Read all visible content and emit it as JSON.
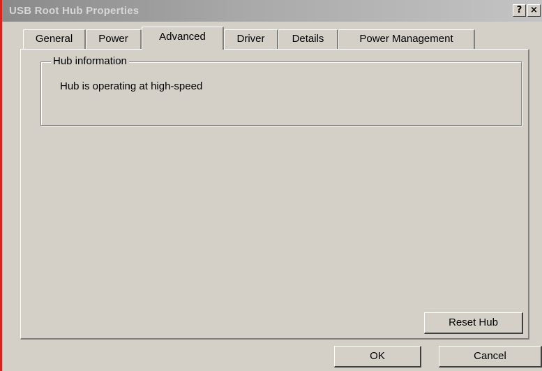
{
  "window": {
    "title": "USB Root Hub Properties",
    "help_label": "?",
    "close_label": "×"
  },
  "tabs": [
    {
      "label": "General"
    },
    {
      "label": "Power"
    },
    {
      "label": "Advanced",
      "active": true
    },
    {
      "label": "Driver"
    },
    {
      "label": "Details"
    },
    {
      "label": "Power Management"
    }
  ],
  "hub_info": {
    "group_title": "Hub information",
    "status_text": "Hub is operating at high-speed"
  },
  "buttons": {
    "reset_label": "Reset Hub",
    "ok_label": "OK",
    "cancel_label": "Cancel"
  },
  "colors": {
    "dialog_face": "#d4d0c8",
    "window_border_accent": "#e1201b"
  }
}
